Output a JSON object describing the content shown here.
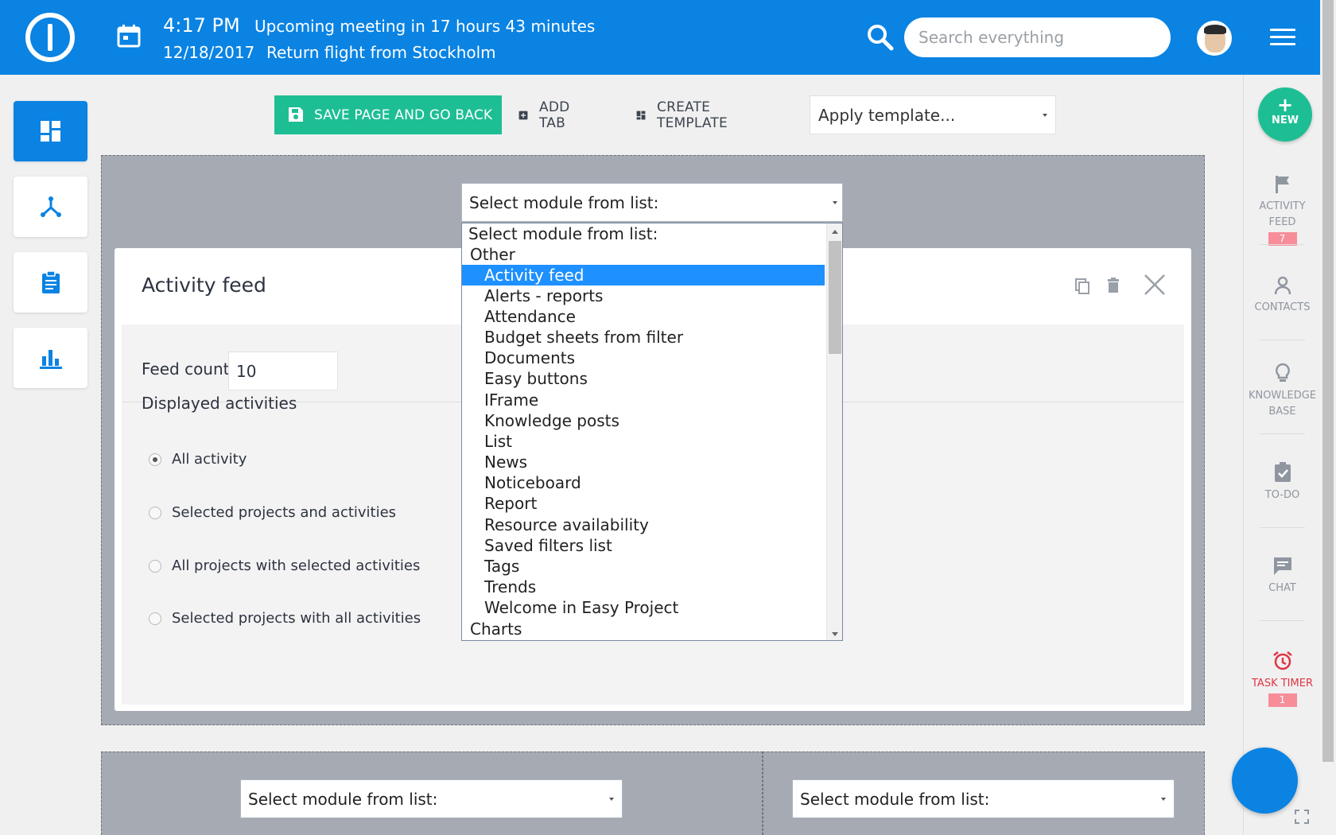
{
  "header": {
    "time": "4:17 PM",
    "date": "12/18/2017",
    "meeting": "Upcoming meeting in 17 hours 43 minutes",
    "flight": "Return flight from Stockholm",
    "search_placeholder": "Search everything",
    "brand_color": "#0a83e3"
  },
  "left_nav": {
    "items": [
      "dashboard-icon",
      "network-icon",
      "clipboard-icon",
      "bar-chart-icon"
    ],
    "active": "dashboard-icon"
  },
  "toolbar": {
    "save_label": "SAVE PAGE AND GO BACK",
    "add_tab_label": "ADD TAB",
    "create_template_label": "CREATE TEMPLATE",
    "apply_template_value": "Apply template..."
  },
  "zone_top": {
    "module_select_value": "Select module from list:"
  },
  "dropdown": {
    "placeholder": "Select module from list:",
    "group_other": "Other",
    "items": [
      "Activity feed",
      "Alerts - reports",
      "Attendance",
      "Budget sheets from filter",
      "Documents",
      "Easy buttons",
      "IFrame",
      "Knowledge posts",
      "List",
      "News",
      "Noticeboard",
      "Report",
      "Resource availability",
      "Saved filters list",
      "Tags",
      "Trends",
      "Welcome in Easy Project"
    ],
    "selected": "Activity feed",
    "group_charts": "Charts"
  },
  "card": {
    "title": "Activity feed",
    "feed_count_label": "Feed count",
    "feed_count_value": "10",
    "displayed_label": "Displayed activities",
    "options": [
      "All activity",
      "Selected projects and activities",
      "All projects with selected activities",
      "Selected projects with all activities"
    ],
    "selected_option": "All activity"
  },
  "zone_bottom": {
    "left_select_value": "Select module from list:",
    "right_select_value": "Select module from list:"
  },
  "right_nav": {
    "new_label": "NEW",
    "activity_label_1": "ACTIVITY",
    "activity_label_2": "FEED",
    "activity_badge": "7",
    "contacts_label": "CONTACTS",
    "kb_label_1": "KNOWLEDGE",
    "kb_label_2": "BASE",
    "todo_label": "TO-DO",
    "chat_label": "CHAT",
    "timer_label": "TASK TIMER",
    "timer_badge": "1"
  }
}
